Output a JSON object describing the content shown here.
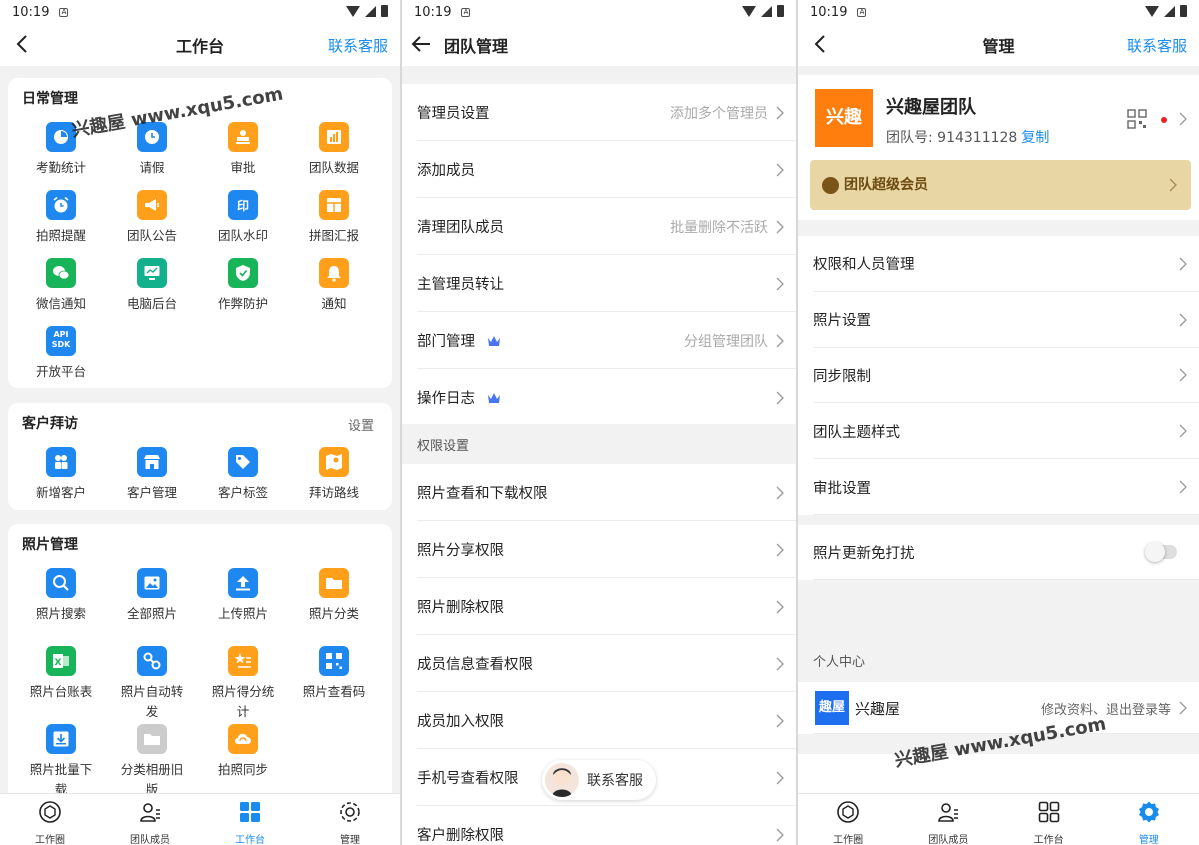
{
  "status": {
    "time": "10:19"
  },
  "p1": {
    "title": "工作台",
    "contact": "联系客服",
    "daily": {
      "title": "日常管理",
      "items": [
        {
          "label": "考勤统计",
          "icon": "clock-chart-icon"
        },
        {
          "label": "请假",
          "icon": "clock-icon"
        },
        {
          "label": "审批",
          "icon": "stamp-icon"
        },
        {
          "label": "团队数据",
          "icon": "bar-chart-icon"
        },
        {
          "label": "拍照提醒",
          "icon": "alarm-icon"
        },
        {
          "label": "团队公告",
          "icon": "megaphone-icon"
        },
        {
          "label": "团队水印",
          "icon": "watermark-icon"
        },
        {
          "label": "拼图汇报",
          "icon": "collage-icon"
        },
        {
          "label": "微信通知",
          "icon": "wechat-icon"
        },
        {
          "label": "电脑后台",
          "icon": "monitor-icon"
        },
        {
          "label": "作弊防护",
          "icon": "shield-icon"
        },
        {
          "label": "通知",
          "icon": "bell-icon"
        },
        {
          "label": "开放平台",
          "icon": "api-sdk-icon",
          "badge_line1": "API",
          "badge_line2": "SDK"
        }
      ]
    },
    "visit": {
      "title": "客户拜访",
      "setting": "设置",
      "items": [
        {
          "label": "新增客户",
          "icon": "add-customer-icon"
        },
        {
          "label": "客户管理",
          "icon": "store-icon"
        },
        {
          "label": "客户标签",
          "icon": "tag-icon"
        },
        {
          "label": "拜访路线",
          "icon": "map-route-icon"
        }
      ]
    },
    "photo": {
      "title": "照片管理",
      "items": [
        {
          "label": "照片搜索",
          "icon": "search-icon"
        },
        {
          "label": "全部照片",
          "icon": "image-icon"
        },
        {
          "label": "上传照片",
          "icon": "upload-icon"
        },
        {
          "label": "照片分类",
          "icon": "folder-icon"
        },
        {
          "label": "照片台账表",
          "icon": "excel-icon"
        },
        {
          "label": "照片自动转发",
          "icon": "link-icon"
        },
        {
          "label": "照片得分统计",
          "icon": "star-list-icon"
        },
        {
          "label": "照片查看码",
          "icon": "qr-code-icon"
        },
        {
          "label": "照片批量下载",
          "icon": "download-icon"
        },
        {
          "label": "分类相册旧版",
          "icon": "album-folder-icon"
        },
        {
          "label": "拍照同步",
          "icon": "cloud-sync-icon"
        }
      ]
    },
    "watermark": "兴趣屋 www.xqu5.com"
  },
  "tabs": [
    {
      "label": "工作圈"
    },
    {
      "label": "团队成员"
    },
    {
      "label": "工作台"
    },
    {
      "label": "管理"
    }
  ],
  "p2": {
    "title": "团队管理",
    "rows": [
      {
        "label": "管理员设置",
        "hint": "添加多个管理员"
      },
      {
        "label": "添加成员",
        "hint": ""
      },
      {
        "label": "清理团队成员",
        "hint": "批量删除不活跃"
      },
      {
        "label": "主管理员转让",
        "hint": ""
      },
      {
        "label": "部门管理",
        "hint": "分组管理团队",
        "crown": true
      },
      {
        "label": "操作日志",
        "hint": "",
        "crown": true
      }
    ],
    "perm_header": "权限设置",
    "perm_rows": [
      {
        "label": "照片查看和下载权限"
      },
      {
        "label": "照片分享权限"
      },
      {
        "label": "照片删除权限"
      },
      {
        "label": "成员信息查看权限"
      },
      {
        "label": "成员加入权限"
      },
      {
        "label": "手机号查看权限"
      },
      {
        "label": "客户删除权限"
      }
    ],
    "float_contact": "联系客服"
  },
  "p3": {
    "title": "管理",
    "contact": "联系客服",
    "team_logo": "兴趣",
    "team_name": "兴趣屋团队",
    "team_id_label": "团队号: 914311128",
    "copy": "复制",
    "vip": "团队超级会员",
    "rows": [
      {
        "label": "权限和人员管理"
      },
      {
        "label": "照片设置"
      },
      {
        "label": "同步限制"
      },
      {
        "label": "团队主题样式"
      },
      {
        "label": "审批设置"
      }
    ],
    "toggle_row": "照片更新免打扰",
    "toggle_on": false,
    "personal_header": "个人中心",
    "me_logo": "趣屋",
    "me_name": "兴趣屋",
    "me_hint": "修改资料、退出登录等",
    "watermark": "兴趣屋 www.xqu5.com"
  }
}
